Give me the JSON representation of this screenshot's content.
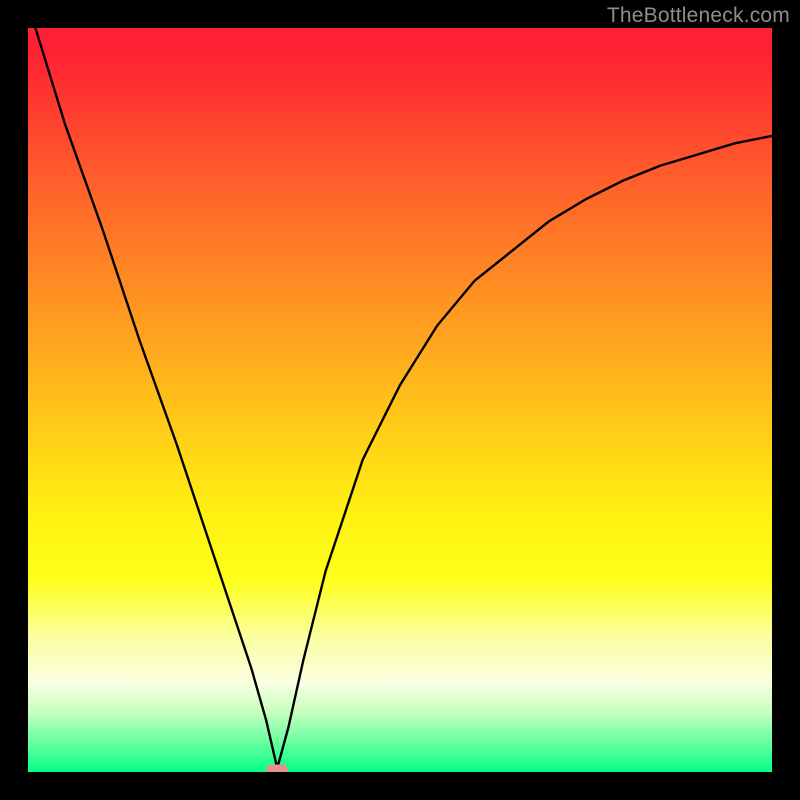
{
  "watermark": "TheBottleneck.com",
  "chart_data": {
    "type": "line",
    "title": "",
    "xlabel": "",
    "ylabel": "",
    "xlim": [
      0,
      100
    ],
    "ylim": [
      0,
      100
    ],
    "grid": false,
    "legend": false,
    "series": [
      {
        "name": "bottleneck-curve",
        "color": "#000000",
        "x": [
          1,
          5,
          10,
          15,
          20,
          25,
          28,
          30,
          32,
          33.5,
          35,
          37,
          40,
          45,
          50,
          55,
          60,
          65,
          70,
          75,
          80,
          85,
          90,
          95,
          100
        ],
        "values": [
          100,
          87,
          73,
          58,
          44,
          29,
          20,
          14,
          7,
          0.5,
          6,
          15,
          27,
          42,
          52,
          60,
          66,
          70,
          74,
          77,
          79.5,
          81.5,
          83,
          84.5,
          85.5
        ]
      }
    ],
    "marker": {
      "x": 33.5,
      "y": 0.3,
      "color": "#e89090"
    },
    "background_gradient": {
      "stops": [
        {
          "pos": 0,
          "color": "#fe2033"
        },
        {
          "pos": 20,
          "color": "#ff5d2b"
        },
        {
          "pos": 35,
          "color": "#ff8e23"
        },
        {
          "pos": 50,
          "color": "#ffbf1a"
        },
        {
          "pos": 65,
          "color": "#fff011"
        },
        {
          "pos": 82,
          "color": "#fbffa2"
        },
        {
          "pos": 92,
          "color": "#c6ffbe"
        },
        {
          "pos": 100,
          "color": "#00ff88"
        }
      ]
    }
  }
}
